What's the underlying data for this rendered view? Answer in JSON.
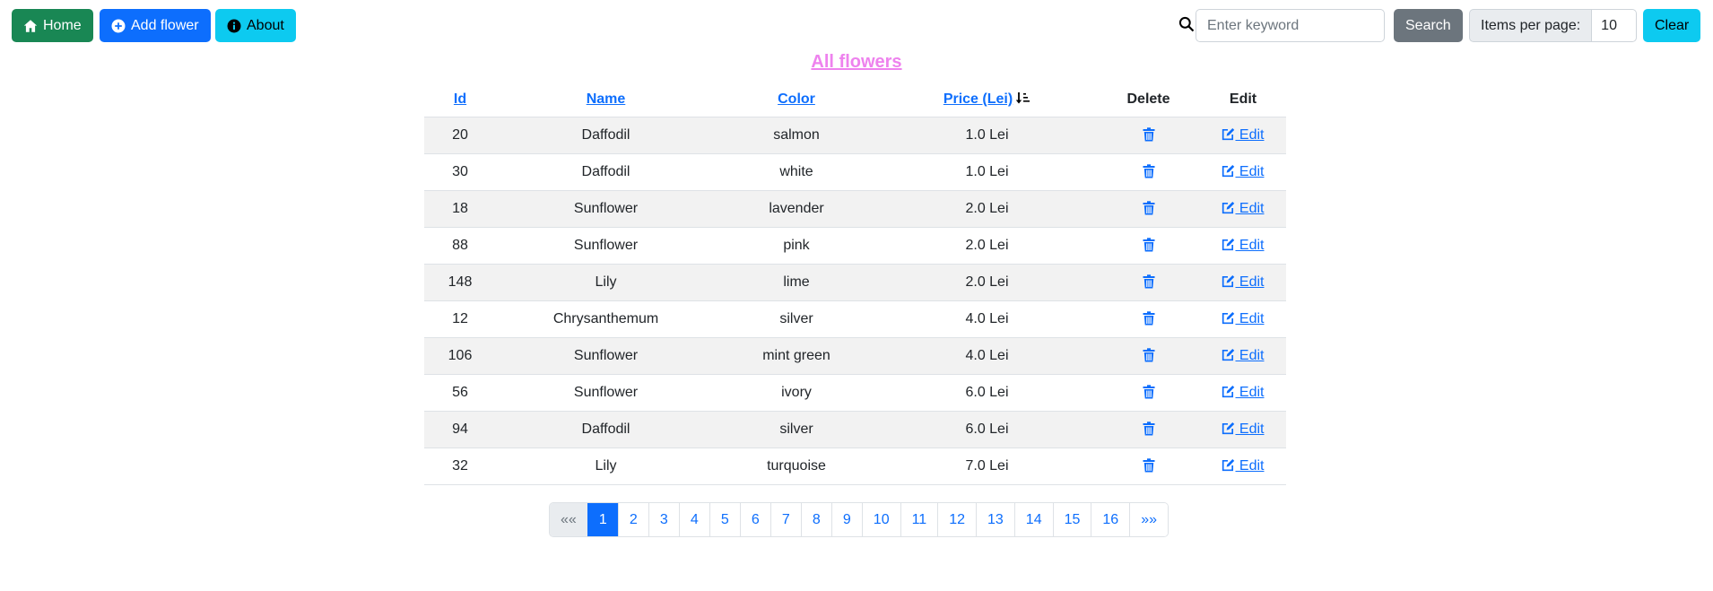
{
  "nav": {
    "home_label": "Home",
    "add_label": "Add flower",
    "about_label": "About"
  },
  "search": {
    "placeholder": "Enter keyword",
    "value": "",
    "button_label": "Search",
    "items_per_page_label": "Items per page:",
    "items_per_page_value": "10",
    "clear_label": "Clear"
  },
  "page_title": "All flowers",
  "table": {
    "headers": {
      "id": "Id",
      "name": "Name",
      "color": "Color",
      "price": "Price (Lei)",
      "delete": "Delete",
      "edit": "Edit"
    },
    "edit_label": " Edit",
    "rows": [
      {
        "id": "20",
        "name": "Daffodil",
        "color": "salmon",
        "price": "1.0 Lei"
      },
      {
        "id": "30",
        "name": "Daffodil",
        "color": "white",
        "price": "1.0 Lei"
      },
      {
        "id": "18",
        "name": "Sunflower",
        "color": "lavender",
        "price": "2.0 Lei"
      },
      {
        "id": "88",
        "name": "Sunflower",
        "color": "pink",
        "price": "2.0 Lei"
      },
      {
        "id": "148",
        "name": "Lily",
        "color": "lime",
        "price": "2.0 Lei"
      },
      {
        "id": "12",
        "name": "Chrysanthemum",
        "color": "silver",
        "price": "4.0 Lei"
      },
      {
        "id": "106",
        "name": "Sunflower",
        "color": "mint green",
        "price": "4.0 Lei"
      },
      {
        "id": "56",
        "name": "Sunflower",
        "color": "ivory",
        "price": "6.0 Lei"
      },
      {
        "id": "94",
        "name": "Daffodil",
        "color": "silver",
        "price": "6.0 Lei"
      },
      {
        "id": "32",
        "name": "Lily",
        "color": "turquoise",
        "price": "7.0 Lei"
      }
    ]
  },
  "pagination": {
    "first": "««",
    "last": "»»",
    "pages": [
      "1",
      "2",
      "3",
      "4",
      "5",
      "6",
      "7",
      "8",
      "9",
      "10",
      "11",
      "12",
      "13",
      "14",
      "15",
      "16"
    ],
    "active": "1"
  },
  "icons": {
    "home": "home-icon",
    "add": "plus-circle-icon",
    "about": "info-circle-icon",
    "search": "search-icon",
    "sort": "sort-down-icon",
    "delete": "trash-icon",
    "edit": "edit-icon"
  },
  "colors": {
    "success": "#198754",
    "primary": "#0d6efd",
    "info": "#0dcaf0",
    "secondary": "#6c757d",
    "title": "#ee82ee",
    "stripe": "#f2f2f2"
  }
}
